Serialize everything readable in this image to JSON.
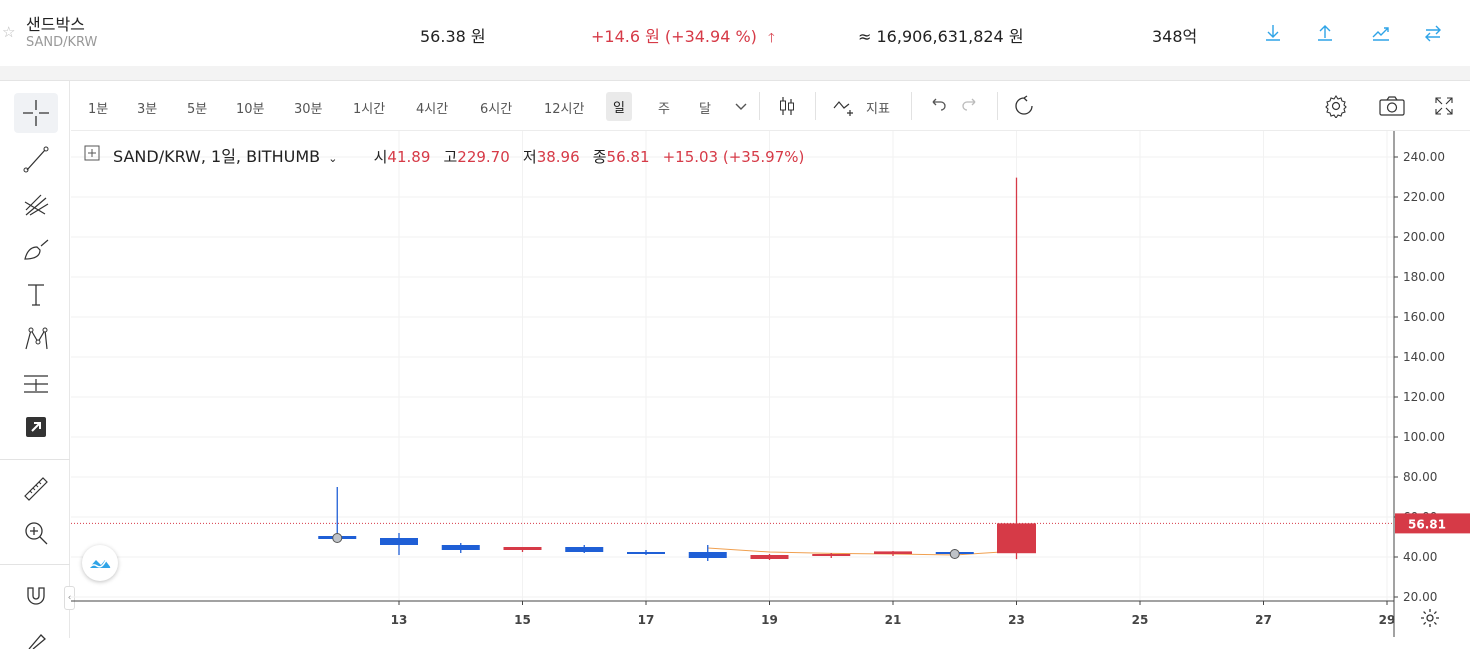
{
  "header": {
    "name": "샌드박스",
    "pair": "SAND/KRW",
    "price": "56.38 원",
    "change": "+14.6 원 (+34.94 %)",
    "volume": "≈ 16,906,631,824 원",
    "market_cap": "348억"
  },
  "timeframes": [
    "1분",
    "3분",
    "5분",
    "10분",
    "30분",
    "1시간",
    "4시간",
    "6시간",
    "12시간",
    "일",
    "주",
    "달"
  ],
  "active_timeframe": "일",
  "toolbar": {
    "indicators_label": "지표"
  },
  "legend": {
    "symbol": "SAND/KRW, 1일, BITHUMB",
    "open_label": "시",
    "open": "41.89",
    "high_label": "고",
    "high": "229.70",
    "low_label": "저",
    "low": "38.96",
    "close_label": "종",
    "close": "56.81",
    "change": "+15.03 (+35.97%)"
  },
  "colors": {
    "up": "#d63a47",
    "down": "#1f5fd6",
    "accent": "#2fa4e7",
    "ma": "#f0a050"
  },
  "chart_data": {
    "type": "candlestick",
    "x_ticks": [
      "13",
      "15",
      "17",
      "19",
      "21",
      "23",
      "25",
      "27",
      "29"
    ],
    "y_ticks": [
      "20.00",
      "40.00",
      "60.00",
      "80.00",
      "100.00",
      "120.00",
      "140.00",
      "160.00",
      "180.00",
      "200.00",
      "220.00",
      "240.00"
    ],
    "ylim": [
      18,
      243
    ],
    "last_price_label": "56.81",
    "last_price": 56.81,
    "candles": [
      {
        "day": 12,
        "open": 50.5,
        "high": 75,
        "low": 48,
        "close": 49.0
      },
      {
        "day": 13,
        "open": 49.5,
        "high": 52,
        "low": 41,
        "close": 46
      },
      {
        "day": 14,
        "open": 46,
        "high": 47,
        "low": 42,
        "close": 43.5
      },
      {
        "day": 15,
        "open": 43.5,
        "high": 45,
        "low": 42.5,
        "close": 45
      },
      {
        "day": 16,
        "open": 45,
        "high": 46,
        "low": 42,
        "close": 42.5
      },
      {
        "day": 17,
        "open": 42.5,
        "high": 43.5,
        "low": 41,
        "close": 41.8
      },
      {
        "day": 18,
        "open": 42.5,
        "high": 46,
        "low": 38,
        "close": 39.5
      },
      {
        "day": 19,
        "open": 39,
        "high": 41.5,
        "low": 38.5,
        "close": 41
      },
      {
        "day": 20,
        "open": 40.5,
        "high": 42,
        "low": 39.5,
        "close": 41.5
      },
      {
        "day": 21,
        "open": 41.5,
        "high": 43,
        "low": 40.5,
        "close": 42.8
      },
      {
        "day": 22,
        "open": 42.5,
        "high": 44,
        "low": 40.5,
        "close": 41.89
      },
      {
        "day": 23,
        "open": 41.89,
        "high": 229.7,
        "low": 38.96,
        "close": 56.81
      }
    ],
    "ma": [
      {
        "day": 18,
        "value": 44.5
      },
      {
        "day": 19,
        "value": 42.5
      },
      {
        "day": 20,
        "value": 41.8
      },
      {
        "day": 21,
        "value": 41.5
      },
      {
        "day": 22,
        "value": 41.0
      },
      {
        "day": 23,
        "value": 43.0
      }
    ],
    "markers": [
      {
        "day": 12,
        "value": 49.5
      },
      {
        "day": 22,
        "value": 41.5
      }
    ]
  }
}
